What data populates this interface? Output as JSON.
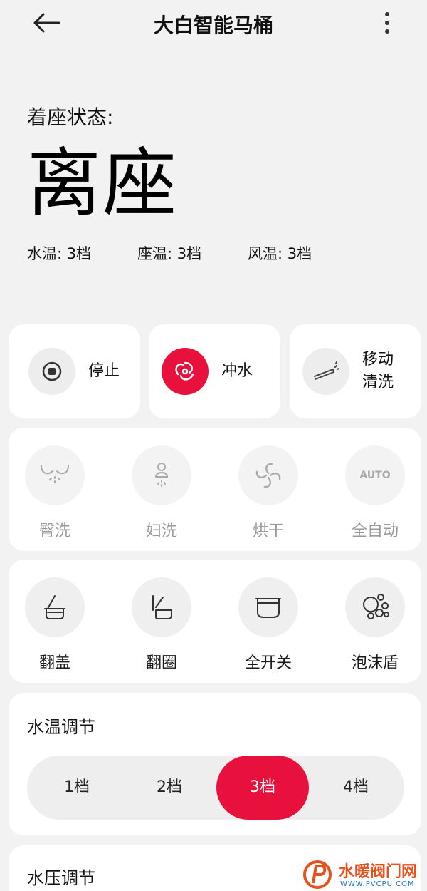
{
  "header": {
    "title": "大白智能马桶"
  },
  "status": {
    "seat_label": "着座状态:",
    "seat_value": "离座",
    "water_temp": "水温: 3档",
    "seat_temp": "座温: 3档",
    "wind_temp": "风温: 3档"
  },
  "modes": [
    {
      "label": "停止",
      "icon": "stop-icon"
    },
    {
      "label": "冲水",
      "icon": "flush-swirl-icon"
    },
    {
      "label": "移动\n清洗",
      "icon": "nozzle-icon"
    }
  ],
  "wash": [
    {
      "label": "臀洗",
      "icon": "hip-wash-icon"
    },
    {
      "label": "妇洗",
      "icon": "feminine-wash-icon"
    },
    {
      "label": "烘干",
      "icon": "fan-dry-icon"
    },
    {
      "label": "全自动",
      "icon": "auto-icon",
      "icon_text": "AUTO"
    }
  ],
  "lid": [
    {
      "label": "翻盖",
      "icon": "lid-open-icon"
    },
    {
      "label": "翻圈",
      "icon": "ring-open-icon"
    },
    {
      "label": "全开关",
      "icon": "full-close-icon"
    },
    {
      "label": "泡沫盾",
      "icon": "foam-shield-icon"
    }
  ],
  "water_temp_adjust": {
    "title": "水温调节",
    "options": [
      "1档",
      "2档",
      "3档",
      "4档"
    ],
    "selected": "3档"
  },
  "water_pressure_adjust": {
    "title": "水压调节"
  },
  "watermark": {
    "text": "水暖阀门网",
    "url": "WWW.PVCPU.COM"
  },
  "colors": {
    "accent": "#e8103c",
    "background": "#f2f2f2",
    "card": "#ffffff"
  }
}
